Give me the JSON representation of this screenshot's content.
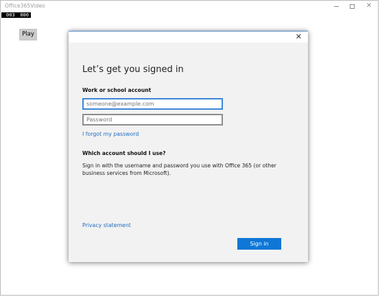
{
  "window": {
    "title": "Office365Video",
    "minimize_icon": "minimize-icon",
    "maximize_icon": "maximize-icon",
    "close_icon": "close-icon",
    "close_glyph": "✕"
  },
  "counter": {
    "left": "003",
    "right": "000"
  },
  "player": {
    "play_label": "Play"
  },
  "dialog": {
    "close_icon": "close-icon",
    "close_glyph": "✕",
    "title": "Let’s get you signed in",
    "account_label": "Work or school account",
    "email_placeholder": "someone@example.com",
    "email_value": "",
    "password_placeholder": "Password",
    "password_value": "",
    "forgot_link": "I forgot my password",
    "which_account_heading": "Which account should I use?",
    "which_account_text": "Sign in with the username and password you use with Office 365 (or other business services from Microsoft).",
    "privacy_link": "Privacy statement",
    "signin_label": "Sign in",
    "accent_color": "#0f77d6"
  }
}
